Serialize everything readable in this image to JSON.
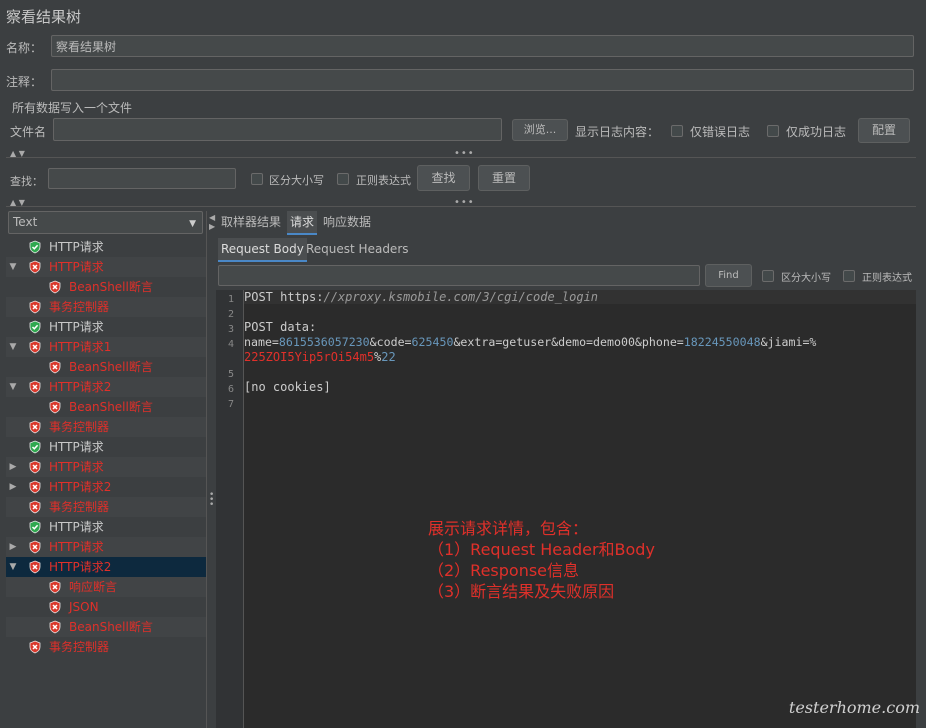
{
  "title": "察看结果树",
  "name_label": "名称：",
  "name_value": "察看结果树",
  "comment_label": "注释：",
  "file_section_label": "所有数据写入一个文件",
  "filename_label": "文件名",
  "browse_label": "浏览...",
  "log_display_label": "显示日志内容：",
  "errors_only_label": "仅错误日志",
  "success_only_label": "仅成功日志",
  "config_label": "配置",
  "search_label": "查找：",
  "case_sensitive_label": "区分大小写",
  "regex_label": "正则表达式",
  "find_button": "查找",
  "reset_button": "重置",
  "renderer_select": "Text",
  "tree": [
    {
      "label": "HTTP请求",
      "status": "ok",
      "level": 0,
      "expander": ""
    },
    {
      "label": "HTTP请求",
      "status": "fail",
      "level": 0,
      "expander": "▼"
    },
    {
      "label": "BeanShell断言",
      "status": "fail",
      "level": 1,
      "expander": ""
    },
    {
      "label": "事务控制器",
      "status": "fail",
      "level": 0,
      "expander": ""
    },
    {
      "label": "HTTP请求",
      "status": "ok",
      "level": 0,
      "expander": ""
    },
    {
      "label": "HTTP请求1",
      "status": "fail",
      "level": 0,
      "expander": "▼"
    },
    {
      "label": "BeanShell断言",
      "status": "fail",
      "level": 1,
      "expander": ""
    },
    {
      "label": "HTTP请求2",
      "status": "fail",
      "level": 0,
      "expander": "▼"
    },
    {
      "label": "BeanShell断言",
      "status": "fail",
      "level": 1,
      "expander": ""
    },
    {
      "label": "事务控制器",
      "status": "fail",
      "level": 0,
      "expander": ""
    },
    {
      "label": "HTTP请求",
      "status": "ok",
      "level": 0,
      "expander": ""
    },
    {
      "label": "HTTP请求",
      "status": "fail",
      "level": 0,
      "expander": "▶"
    },
    {
      "label": "HTTP请求2",
      "status": "fail",
      "level": 0,
      "expander": "▶"
    },
    {
      "label": "事务控制器",
      "status": "fail",
      "level": 0,
      "expander": ""
    },
    {
      "label": "HTTP请求",
      "status": "ok",
      "level": 0,
      "expander": ""
    },
    {
      "label": "HTTP请求",
      "status": "fail",
      "level": 0,
      "expander": "▶"
    },
    {
      "label": "HTTP请求2",
      "status": "fail",
      "level": 0,
      "expander": "▼",
      "selected": true
    },
    {
      "label": "响应断言",
      "status": "fail",
      "level": 1,
      "expander": ""
    },
    {
      "label": "JSON",
      "status": "fail",
      "level": 1,
      "expander": ""
    },
    {
      "label": "BeanShell断言",
      "status": "fail",
      "level": 1,
      "expander": ""
    },
    {
      "label": "事务控制器",
      "status": "fail",
      "level": 0,
      "expander": ""
    }
  ],
  "tabs": [
    "取样器结果",
    "请求",
    "响应数据"
  ],
  "active_tab": "请求",
  "subtabs": [
    "Request Body",
    "Request Headers"
  ],
  "active_subtab": "Request Body",
  "find_small_button": "Find",
  "find_case_label": "区分大小写",
  "find_regex_label": "正则表达式",
  "code": {
    "line1_method": "POST ",
    "line1_scheme": "https:",
    "line1_url": "//xproxy.ksmobile.com/3/cgi/code_login",
    "line3": "POST data:",
    "line4_a": "name=",
    "line4_b": "8615536057230",
    "line4_c": "&code=",
    "line4_d": "625450",
    "line4_e": "&extra=getuser&demo=demo00&phone=",
    "line4_f": "18224550048",
    "line4_g": "&jiami=%",
    "line4b_a": "225ZOI5Yip5rOi54m5",
    "line4b_b": "%",
    "line4b_c": "22",
    "line6": "[no cookies]",
    "line_numbers": [
      "1",
      "2",
      "3",
      "4",
      "5",
      "6",
      "7"
    ]
  },
  "annotation": {
    "line1": "展示请求详情，包含：",
    "line2": "（1）Request Header和Body",
    "line3": "（2）Response信息",
    "line4": "（3）断言结果及失败原因"
  },
  "watermark": "testerhome.com",
  "colors": {
    "ok": "#2fa84f",
    "fail": "#d9382c",
    "accent": "#4a88c7"
  }
}
